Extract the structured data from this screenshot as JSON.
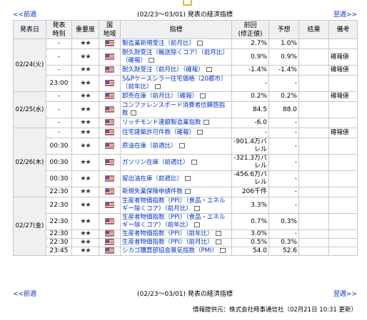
{
  "nav": {
    "prev_label": "<<前週",
    "next_label": "翌週>>",
    "title": "(02/23～03/01) 発表の経済指標"
  },
  "headers": {
    "date": "発表日",
    "time_l1": "発表",
    "time_l2": "時刻",
    "importance": "重要度",
    "country_l1": "国",
    "country_l2": "地域",
    "indicator": "指標",
    "prev_l1": "前回",
    "prev_l2": "(修正値)",
    "forecast": "予想",
    "result": "結果",
    "note": "備考"
  },
  "flag_icon": "us-flag-icon",
  "doc_icon": "document-icon",
  "dates": [
    "02/24(火)",
    "02/25(水)",
    "02/26(木)",
    "02/27(金)"
  ],
  "rows": [
    {
      "time": "-",
      "importance": "★★",
      "indicator": "製造業新規受注（前月比）",
      "prev": "2.7%",
      "forecast": "1.0%",
      "result": "",
      "note": ""
    },
    {
      "time": "-",
      "importance": "★★",
      "indicator": "耐久財受注（輸送除くコア）（前月比）（確報）",
      "prev": "0.9%",
      "forecast": "0.9%",
      "result": "",
      "note": "確報値"
    },
    {
      "time": "-",
      "importance": "★★",
      "indicator": "耐久財受注（前月比）（確報）",
      "prev": "-1.4%",
      "forecast": "-1.4%",
      "result": "",
      "note": "確報値"
    },
    {
      "time": "23:00",
      "importance": "★★",
      "indicator": "S&Pケースシラー住宅価格（20都市）（前年比）",
      "prev": "-",
      "forecast": "-",
      "result": "",
      "note": ""
    },
    {
      "time": "-",
      "importance": "★★",
      "indicator": "卸売在庫（前月比）（確報）",
      "prev": "0.2%",
      "forecast": "0.2%",
      "result": "",
      "note": "確報値"
    },
    {
      "time": "-",
      "importance": "★★",
      "indicator": "コンファレンスボード消費者信頼感指数",
      "prev": "84.5",
      "forecast": "88.0",
      "result": "",
      "note": ""
    },
    {
      "time": "-",
      "importance": "★★",
      "indicator": "リッチモンド連銀製造業指数",
      "prev": "-6.0",
      "forecast": "-",
      "result": "",
      "note": ""
    },
    {
      "time": "-",
      "importance": "★★",
      "indicator": "住宅建築許可件数（確報）",
      "prev": "-",
      "forecast": "-",
      "result": "",
      "note": "確報値"
    },
    {
      "time": "00:30",
      "importance": "★★",
      "indicator": "原油在庫（前週比）",
      "prev": "-901.4万バレル",
      "forecast": "-",
      "result": "",
      "note": ""
    },
    {
      "time": "00:30",
      "importance": "★★",
      "indicator": "ガソリン在庫（前週比）",
      "prev": "-321.3万バレル",
      "forecast": "-",
      "result": "",
      "note": ""
    },
    {
      "time": "00:30",
      "importance": "★★",
      "indicator": "留出油在庫（前週比）",
      "prev": "-456.6万バレル",
      "forecast": "-",
      "result": "",
      "note": ""
    },
    {
      "time": "22:30",
      "importance": "★★",
      "indicator": "新規失業保険申請件数",
      "prev": "206千件",
      "forecast": "-",
      "result": "",
      "note": ""
    },
    {
      "time": "22:30",
      "importance": "★★",
      "indicator": "生産者物価指数（PPI）（食品・エネルギー除くコア）（前月比）",
      "prev": "3.3%",
      "forecast": "-",
      "result": "",
      "note": ""
    },
    {
      "time": "22:30",
      "importance": "★★",
      "indicator": "生産者物価指数（PPI）（食品・エネルギー除くコア）（前年比）",
      "prev": "0.7%",
      "forecast": "0.3%",
      "result": "",
      "note": ""
    },
    {
      "time": "22:30",
      "importance": "★★",
      "indicator": "生産者物価指数（PPI）（前年比）",
      "prev": "3.0%",
      "forecast": "-",
      "result": "",
      "note": ""
    },
    {
      "time": "22:30",
      "importance": "★★",
      "indicator": "生産者物価指数（PPI）（前月比）",
      "prev": "0.5%",
      "forecast": "0.3%",
      "result": "",
      "note": ""
    },
    {
      "time": "23:45",
      "importance": "★★",
      "indicator": "シカゴ購買部協会景気指数（PMI）",
      "prev": "54.0",
      "forecast": "52.6",
      "result": "",
      "note": ""
    }
  ],
  "credit": "情報提供元：株式会社時事通信社（02月21日 10:31 更新）"
}
